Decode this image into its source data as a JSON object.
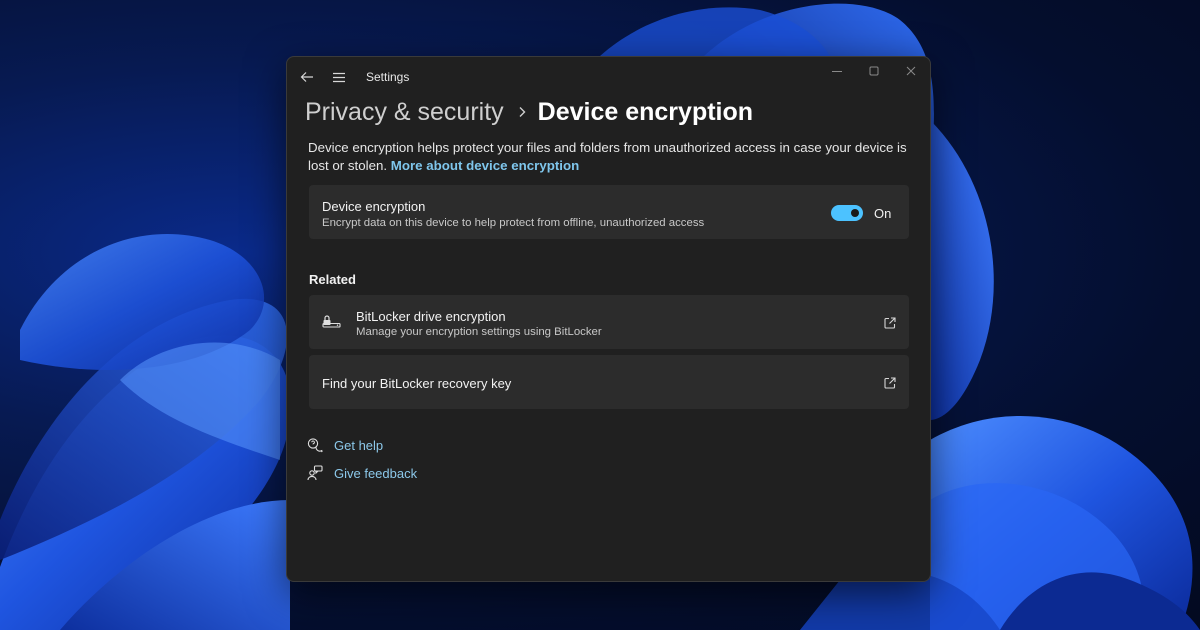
{
  "window": {
    "title": "Settings"
  },
  "breadcrumb": {
    "parent": "Privacy & security",
    "current": "Device encryption"
  },
  "intro": {
    "text": "Device encryption helps protect your files and folders from unauthorized access in case your device is lost or stolen.",
    "link": "More about device encryption"
  },
  "device_encryption": {
    "title": "Device encryption",
    "description": "Encrypt data on this device to help protect from offline, unauthorized access",
    "toggle_state": "On",
    "toggle_on": true,
    "accent_color": "#4cc2ff"
  },
  "related": {
    "heading": "Related",
    "items": [
      {
        "title": "BitLocker drive encryption",
        "description": "Manage your encryption settings using BitLocker",
        "icon": "bitlocker-key-icon",
        "action_icon": "open-external-icon"
      },
      {
        "title": "Find your BitLocker recovery key",
        "action_icon": "open-external-icon"
      }
    ]
  },
  "help": {
    "get_help": "Get help",
    "give_feedback": "Give feedback"
  }
}
